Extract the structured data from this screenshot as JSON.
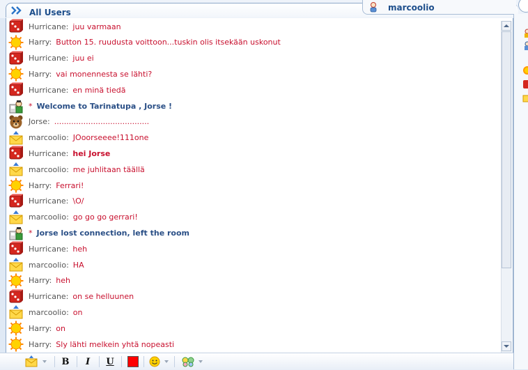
{
  "header": {
    "all_users_label": "All Users",
    "user_tab_label": "marcoolio"
  },
  "colors": {
    "message_text": "#c8102e",
    "system_text": "#2a4f86",
    "username": "#555555"
  },
  "messages": [
    {
      "icon": "dice-icon",
      "user": "Hurricane:",
      "text": "juu varmaan",
      "bold": false
    },
    {
      "icon": "sun-icon",
      "user": "Harry:",
      "text": "Button 15. ruudusta voittoon...tuskin olis itsekään uskonut",
      "bold": false
    },
    {
      "icon": "dice-icon",
      "user": "Hurricane:",
      "text": "juu ei",
      "bold": false
    },
    {
      "icon": "sun-icon",
      "user": "Harry:",
      "text": "vai monennesta se lähti?",
      "bold": false
    },
    {
      "icon": "dice-icon",
      "user": "Hurricane:",
      "text": "en minä tiedä",
      "bold": false
    },
    {
      "icon": "system-icon",
      "system": true,
      "star": "*",
      "text": "Welcome to Tarinatupa , Jorse !"
    },
    {
      "icon": "bear-icon",
      "user": "Jorse:",
      "text": ".......................................",
      "bold": false
    },
    {
      "icon": "envelope-icon",
      "user": "marcoolio:",
      "text": "JOoorseeee!111one",
      "bold": false
    },
    {
      "icon": "dice-icon",
      "user": "Hurricane:",
      "text": "hei Jorse",
      "bold": true
    },
    {
      "icon": "envelope-icon",
      "user": "marcoolio:",
      "text": "me juhlitaan täällä",
      "bold": false
    },
    {
      "icon": "sun-icon",
      "user": "Harry:",
      "text": "Ferrari!",
      "bold": false
    },
    {
      "icon": "dice-icon",
      "user": "Hurricane:",
      "text": "\\O/",
      "bold": false
    },
    {
      "icon": "envelope-icon",
      "user": "marcoolio:",
      "text": "go go go gerrari!",
      "bold": false
    },
    {
      "icon": "system-icon",
      "system": true,
      "star": "*",
      "text": "Jorse lost connection, left the room"
    },
    {
      "icon": "dice-icon",
      "user": "Hurricane:",
      "text": "heh",
      "bold": false
    },
    {
      "icon": "envelope-icon",
      "user": "marcoolio:",
      "text": "HA",
      "bold": false
    },
    {
      "icon": "sun-icon",
      "user": "Harry:",
      "text": "heh",
      "bold": false
    },
    {
      "icon": "dice-icon",
      "user": "Hurricane:",
      "text": "on se helluunen",
      "bold": false
    },
    {
      "icon": "envelope-icon",
      "user": "marcoolio:",
      "text": "on",
      "bold": false
    },
    {
      "icon": "sun-icon",
      "user": "Harry:",
      "text": "on",
      "bold": false
    },
    {
      "icon": "sun-icon",
      "user": "Harry:",
      "text": "Sly lähti melkein yhtä nopeasti",
      "bold": false
    }
  ],
  "toolbar": {
    "bold_label": "B",
    "italic_label": "I",
    "underline_label": "U",
    "text_color": "#ff0000"
  }
}
